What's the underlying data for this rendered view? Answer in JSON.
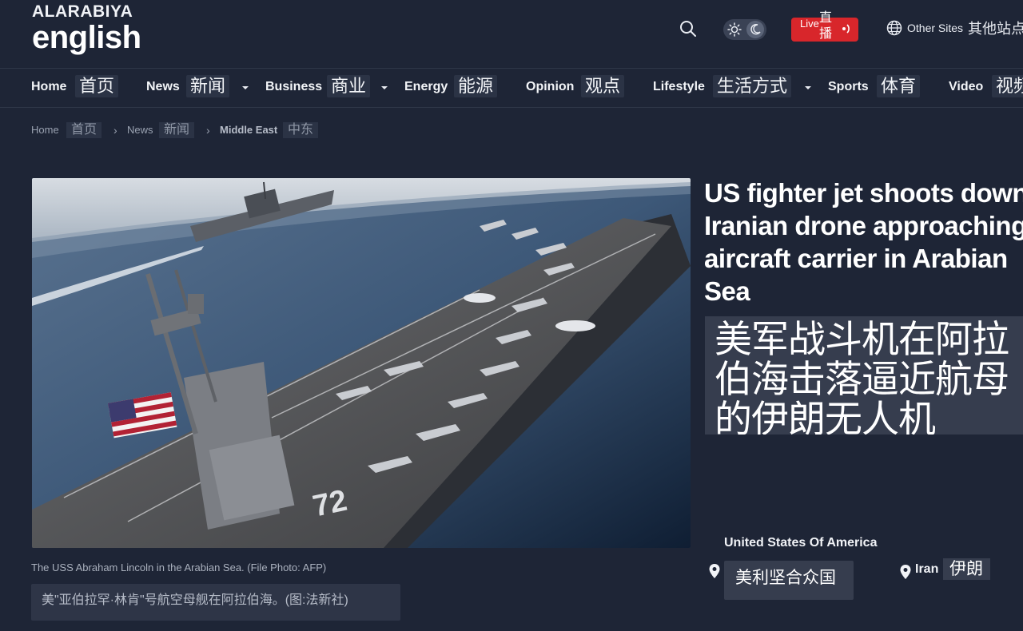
{
  "brand": {
    "top": "ALARABIYA",
    "main": "english"
  },
  "header": {
    "live_en": "Live",
    "live_zh": "直播",
    "other_sites_en": "Other Sites",
    "other_sites_zh": "其他站点"
  },
  "nav": [
    {
      "en": "Home",
      "zh": "首页"
    },
    {
      "en": "News",
      "zh": "新闻"
    },
    {
      "en": "Business",
      "zh": "商业"
    },
    {
      "en": "Energy",
      "zh": "能源"
    },
    {
      "en": "Opinion",
      "zh": "观点"
    },
    {
      "en": "Lifestyle",
      "zh": "生活方式"
    },
    {
      "en": "Sports",
      "zh": "体育"
    },
    {
      "en": "Video",
      "zh": "视频"
    }
  ],
  "breadcrumb": [
    {
      "en": "Home",
      "zh": "首页"
    },
    {
      "en": "News",
      "zh": "新闻"
    },
    {
      "en": "Middle East",
      "zh": "中东"
    }
  ],
  "article": {
    "headline": "US fighter jet shoots down Iranian drone approaching aircraft carrier in Arabian Sea",
    "headline_zh": "美军战斗机在阿拉伯海击落逼近航母的伊朗无人机",
    "image_alt": "USS Abraham Lincoln aircraft carrier at sea",
    "caption_en": "The USS Abraham Lincoln in the Arabian Sea. (File Photo: AFP)",
    "caption_zh": "美\"亚伯拉罕·林肯\"号航空母舰在阿拉伯海。(图:法新社)",
    "tags_title": "United States Of America",
    "tag_usa_zh": "美利坚合众国",
    "tag_iran_en": "Iran",
    "tag_iran_zh": "伊朗",
    "hull_number": "72"
  },
  "colors": {
    "background": "#1e2536",
    "live_red": "#d8262b",
    "chip_bg": "#363d4e"
  }
}
